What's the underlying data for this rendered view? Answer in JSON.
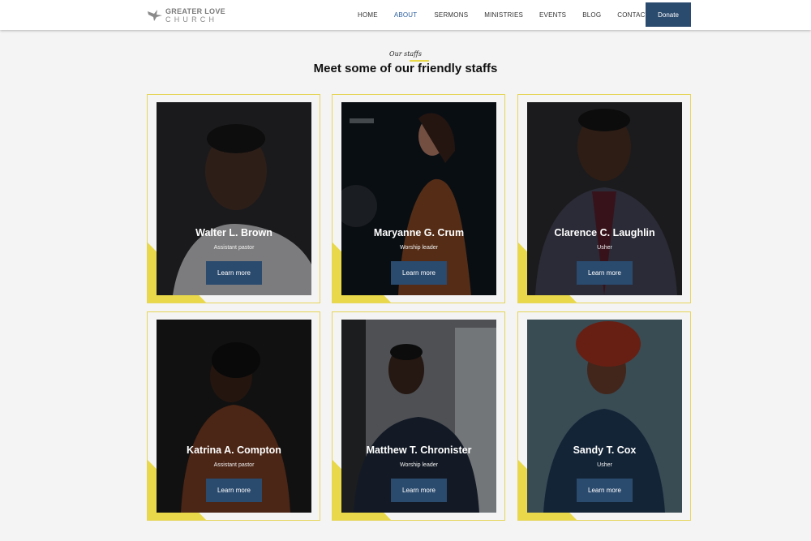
{
  "header": {
    "logo": {
      "line1": "GREATER LOVE",
      "line2": "CHURCH"
    },
    "nav": [
      {
        "label": "HOME",
        "active": false
      },
      {
        "label": "ABOUT",
        "active": true
      },
      {
        "label": "SERMONS",
        "active": false
      },
      {
        "label": "MINISTRIES",
        "active": false
      },
      {
        "label": "EVENTS",
        "active": false
      },
      {
        "label": "BLOG",
        "active": false
      },
      {
        "label": "CONTACT",
        "active": false
      }
    ],
    "donate_label": "Donate"
  },
  "section": {
    "eyebrow": "Our staffs",
    "title": "Meet some of our friendly staffs"
  },
  "staff": [
    {
      "name": "Walter L. Brown",
      "role": "Assistant pastor",
      "button": "Learn more"
    },
    {
      "name": "Maryanne G. Crum",
      "role": "Worship leader",
      "button": "Learn more"
    },
    {
      "name": "Clarence C. Laughlin",
      "role": "Usher",
      "button": "Learn more"
    },
    {
      "name": "Katrina A. Compton",
      "role": "Assistant pastor",
      "button": "Learn more"
    },
    {
      "name": "Matthew T. Chronister",
      "role": "Worship leader",
      "button": "Learn more"
    },
    {
      "name": "Sandy T. Cox",
      "role": "Usher",
      "button": "Learn more"
    }
  ],
  "colors": {
    "accent_yellow": "#e8d84a",
    "button_navy": "#2a4a6e",
    "nav_active": "#2c5fa0",
    "page_bg": "#f4f4f4"
  },
  "icons": {
    "logo": "dove-icon"
  }
}
